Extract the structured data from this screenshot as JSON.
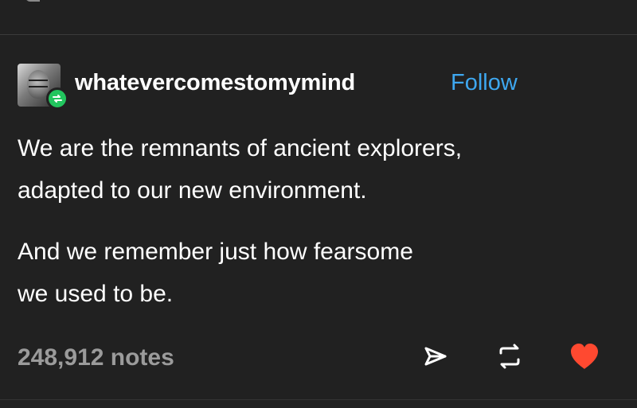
{
  "post": {
    "username": "whatevercomestomymind",
    "follow_label": "Follow",
    "paragraphs": [
      {
        "lines": [
          "We are the remnants of ancient explorers,",
          "adapted to our new environment."
        ]
      },
      {
        "lines": [
          "And we remember just how fearsome",
          "we used to be."
        ]
      }
    ],
    "notes_label": "248,912 notes"
  },
  "icons": {
    "avatar": "user-avatar",
    "reblog_badge": "reblog-icon",
    "share": "share-icon",
    "reblog": "reblog-icon",
    "like": "heart-icon"
  },
  "colors": {
    "background": "#212121",
    "follow": "#3ea7ef",
    "reblog_badge": "#22c55e",
    "like": "#ff4930",
    "muted": "#9b9b9b"
  }
}
